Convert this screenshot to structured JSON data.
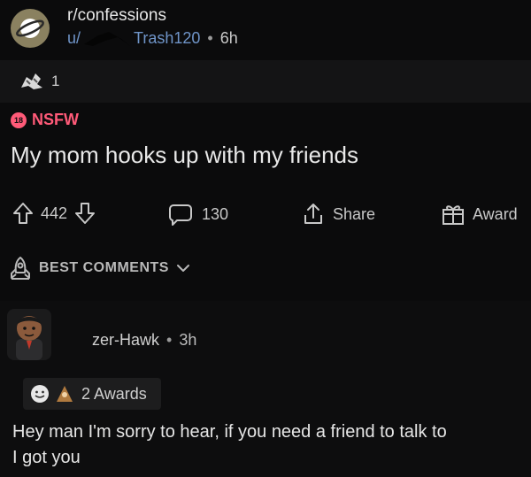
{
  "post": {
    "subreddit": "r/confessions",
    "user_prefix": "u/",
    "username": "Trash120",
    "separator": "•",
    "age": "6h",
    "award_count": "1",
    "nsfw_badge": "18",
    "nsfw_label": "NSFW",
    "title": "My mom hooks up with my friends"
  },
  "actions": {
    "upvotes": "442",
    "comments": "130",
    "share": "Share",
    "award": "Award"
  },
  "sort": {
    "label": "BEST COMMENTS"
  },
  "comment": {
    "username": "zer-Hawk",
    "separator": "•",
    "age": "3h",
    "awards_label": "2 Awards",
    "text": "Hey man I'm sorry to hear, if you need a friend to talk to\nI got you"
  },
  "colors": {
    "background": "#0b0b0c",
    "nsfw": "#ff5a78",
    "link_blue": "#6f94c8",
    "subreddit_icon": "#8a8160"
  },
  "icons": [
    "planet-icon",
    "scribble-mark",
    "award-icon",
    "nsfw-icon",
    "upvote-icon",
    "downvote-icon",
    "comment-icon",
    "share-icon",
    "gift-icon",
    "rocket-icon",
    "chevron-down-icon",
    "avatar",
    "wholesome-icon",
    "award-small-icon"
  ]
}
